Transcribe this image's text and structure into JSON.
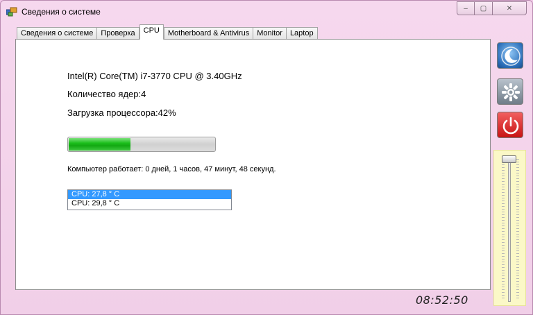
{
  "window": {
    "title": "Сведения о системе",
    "controls": {
      "minimize": "–",
      "maximize": "▢",
      "close": "✕"
    }
  },
  "tabs": [
    {
      "label": "Сведения о системе",
      "active": false
    },
    {
      "label": "Проверка",
      "active": false
    },
    {
      "label": "CPU",
      "active": true
    },
    {
      "label": "Motherboard & Antivirus",
      "active": false
    },
    {
      "label": "Monitor",
      "active": false
    },
    {
      "label": "Laptop",
      "active": false
    }
  ],
  "cpu": {
    "name": "Intel(R) Core(TM) i7-3770 CPU @ 3.40GHz",
    "cores": "Количество ядер:4",
    "load": "Загрузка процессора:42%",
    "load_fraction": 0.42,
    "uptime": "Компьютер работает: 0 дней, 1 часов, 47 минут, 48 секунд.",
    "temps": [
      {
        "label": "CPU: 27,8 ° C",
        "selected": true
      },
      {
        "label": "CPU: 29,8 ° C",
        "selected": false
      }
    ]
  },
  "clock": "08:52:50",
  "side_buttons": {
    "sleep": "moon-icon",
    "settings": "gear-icon",
    "power": "power-icon"
  },
  "slider": {
    "value": 1.0
  },
  "colors": {
    "progress": "#12a812",
    "selected": "#3399ff",
    "power": "#c81414",
    "sleep": "#2c6fb9"
  }
}
